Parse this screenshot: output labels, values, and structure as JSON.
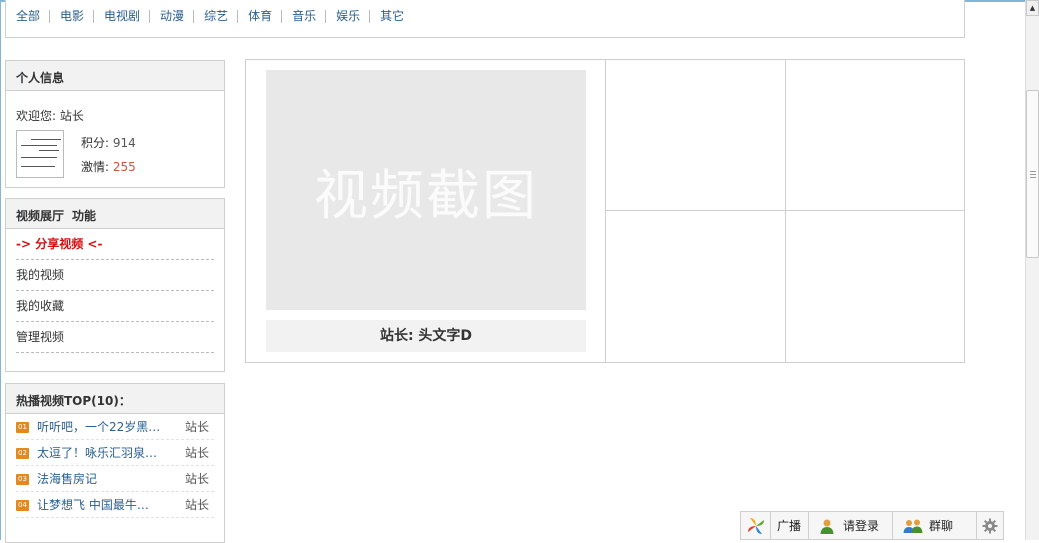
{
  "nav": {
    "categories": [
      "全部",
      "电影",
      "电视剧",
      "动漫",
      "综艺",
      "体育",
      "音乐",
      "娱乐",
      "其它"
    ]
  },
  "profile": {
    "title": "个人信息",
    "welcome": "欢迎您: 站长",
    "points_label": "积分: ",
    "points_value": "914",
    "mood_label": "激情: ",
    "mood_value": "255"
  },
  "functions": {
    "title": "视频展厅",
    "subtitle": "功能",
    "items": [
      "-> 分享视频 <-",
      "我的视频",
      "我的收藏",
      "管理视频"
    ]
  },
  "top_videos": {
    "title": "热播视频TOP(10)：",
    "items": [
      {
        "rank": "01",
        "title": "听听吧，一个22岁黑…",
        "user": "站长"
      },
      {
        "rank": "02",
        "title": "太逗了！咏乐汇羽泉…",
        "user": "站长"
      },
      {
        "rank": "03",
        "title": "法海售房记",
        "user": "站长"
      },
      {
        "rank": "04",
        "title": "让梦想飞 中国最牛…",
        "user": "站长"
      }
    ]
  },
  "grid": {
    "screenshot_text": "视频截图",
    "caption": "站长: 头文字D"
  },
  "toolbar": {
    "broadcast": "广播",
    "login": "请登录",
    "chat": "群聊"
  },
  "icons": {
    "logo": "pinwheel-icon",
    "login": "user-icon",
    "chat": "group-icon",
    "settings": "gear-icon"
  },
  "colors": {
    "link": "#2a5f8f",
    "active": "#d21010",
    "rank_badge": "#e58a1a",
    "mood": "#d0523a"
  }
}
